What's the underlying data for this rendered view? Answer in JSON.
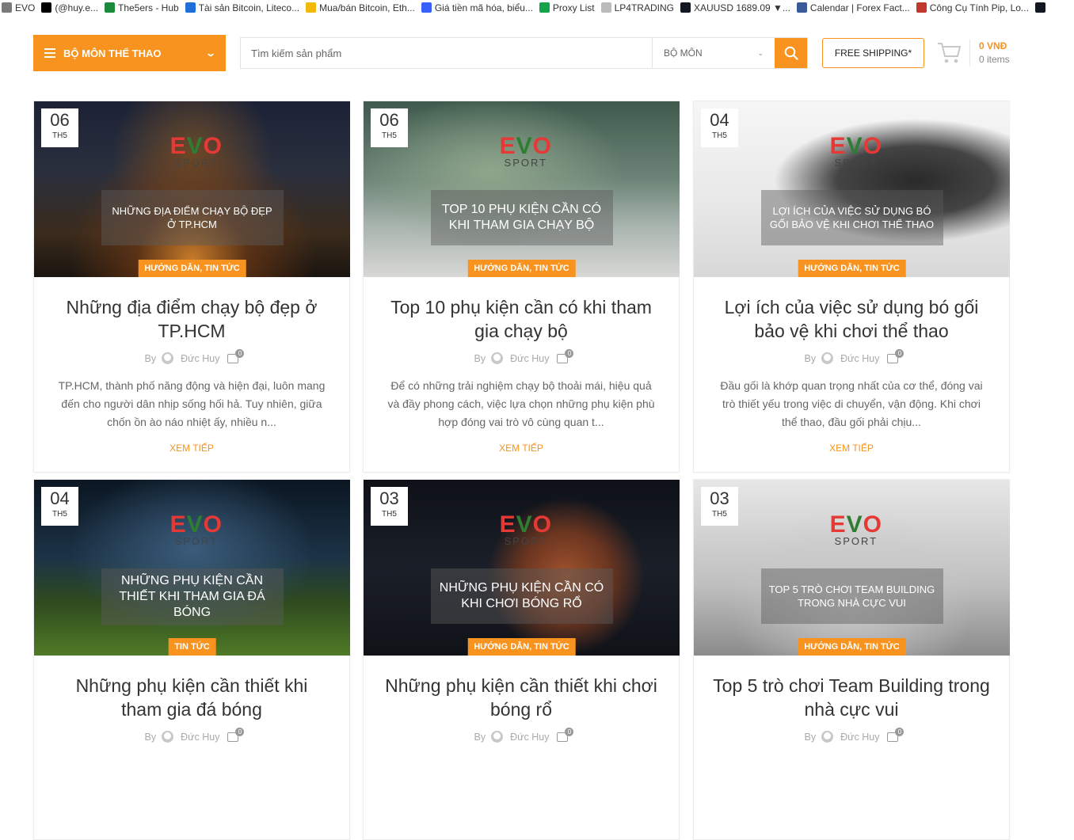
{
  "bookmarks": [
    {
      "label": "EVO",
      "icon": "key-icon",
      "color": "#7a7a7a"
    },
    {
      "label": "(@huy.e...",
      "icon": "tiktok-icon",
      "color": "#000000"
    },
    {
      "label": "The5ers - Hub",
      "icon": "the5ers-icon",
      "color": "#1b8a3a"
    },
    {
      "label": "Tài sản Bitcoin, Liteco...",
      "icon": "mountain-icon",
      "color": "#1e6fd9"
    },
    {
      "label": "Mua/bán Bitcoin, Eth...",
      "icon": "binance-icon",
      "color": "#f0b90b"
    },
    {
      "label": "Giá tiền mã hóa, biểu...",
      "icon": "coinmarketcap-icon",
      "color": "#3861fb"
    },
    {
      "label": "Proxy List",
      "icon": "bars-icon",
      "color": "#16a34a"
    },
    {
      "label": "LP4TRADING",
      "icon": "page-icon",
      "color": "#bbbbbb"
    },
    {
      "label": "XAUUSD 1689.09 ▼...",
      "icon": "tradingview-icon",
      "color": "#131722"
    },
    {
      "label": "Calendar | Forex Fact...",
      "icon": "forexfactory-icon",
      "color": "#3a5a9a"
    },
    {
      "label": "Công Cụ Tính Pip, Lo...",
      "icon": "calculator-icon",
      "color": "#c0392b"
    },
    {
      "label": "",
      "icon": "tradingview-icon",
      "color": "#131722"
    }
  ],
  "header": {
    "category_label": "BỘ MÔN THỂ THAO",
    "search_placeholder": "Tìm kiếm sản phẩm",
    "search_select": "BỘ MÔN",
    "shipping_label": "FREE SHIPPING*",
    "cart_amount": "0 VNĐ",
    "cart_items": "0 items",
    "accent": "#f7931e"
  },
  "logo": {
    "evo_e": "E",
    "evo_v": "V",
    "evo_o": "O",
    "sport": "SPORT"
  },
  "posts": [
    {
      "day": "06",
      "month": "TH5",
      "overlay": "NHỮNG ĐỊA ĐIỂM CHẠY BỘ ĐẸP Ở TP.HCM",
      "tags": "HƯỚNG DẪN, TIN TỨC",
      "title": "Những địa điểm chạy bộ đẹp ở TP.HCM",
      "by": "By",
      "author": "Đức Huy",
      "comments": "0",
      "excerpt": "TP.HCM, thành phố năng động và hiện đại, luôn mang đến cho người dân nhịp sống hối hả. Tuy nhiên, giữa chốn ồn ào náo nhiệt ấy, nhiều n...",
      "more": "XEM TIẾP"
    },
    {
      "day": "06",
      "month": "TH5",
      "overlay": "TOP 10 PHỤ KIỆN CẦN CÓ KHI THAM GIA CHẠY BỘ",
      "tags": "HƯỚNG DẪN, TIN TỨC",
      "title": "Top 10 phụ kiện cần có khi tham gia chạy bộ",
      "by": "By",
      "author": "Đức Huy",
      "comments": "0",
      "excerpt": "Để có những trải nghiệm chạy bộ thoải mái, hiệu quả và đầy phong cách, việc lựa chọn những phụ kiện phù hợp đóng vai trò vô cùng quan t...",
      "more": "XEM TIẾP"
    },
    {
      "day": "04",
      "month": "TH5",
      "overlay": "LỢI ÍCH CỦA VIỆC SỬ DỤNG BÓ GỐI BẢO VỆ KHI CHƠI THỂ THAO",
      "tags": "HƯỚNG DẪN, TIN TỨC",
      "title": "Lợi ích của việc sử dụng bó gối bảo vệ khi chơi thể thao",
      "by": "By",
      "author": "Đức Huy",
      "comments": "0",
      "excerpt": "Đầu gối là khớp quan trọng nhất của cơ thể, đóng vai trò thiết yếu trong việc di chuyển, vận động. Khi chơi thể thao, đầu gối phải chịu...",
      "more": "XEM TIẾP"
    },
    {
      "day": "04",
      "month": "TH5",
      "overlay": "NHỮNG PHỤ KIỆN CẦN THIẾT KHI THAM GIA ĐÁ BÓNG",
      "tags": "TIN TỨC",
      "title": "Những phụ kiện cần thiết khi tham gia đá bóng",
      "by": "By",
      "author": "Đức Huy",
      "comments": "0",
      "excerpt": "",
      "more": ""
    },
    {
      "day": "03",
      "month": "TH5",
      "overlay": "NHỮNG PHỤ KIỆN CẦN CÓ KHI CHƠI BÓNG RỔ",
      "tags": "HƯỚNG DẪN, TIN TỨC",
      "title": "Những phụ kiện cần thiết khi chơi bóng rổ",
      "by": "By",
      "author": "Đức Huy",
      "comments": "0",
      "excerpt": "",
      "more": ""
    },
    {
      "day": "03",
      "month": "TH5",
      "overlay": "TOP 5 TRÒ CHƠI TEAM BUILDING TRONG NHÀ CỰC VUI",
      "tags": "HƯỚNG DẪN, TIN TỨC",
      "title": "Top 5 trò chơi Team Building trong nhà cực vui",
      "by": "By",
      "author": "Đức Huy",
      "comments": "0",
      "excerpt": "",
      "more": ""
    }
  ]
}
